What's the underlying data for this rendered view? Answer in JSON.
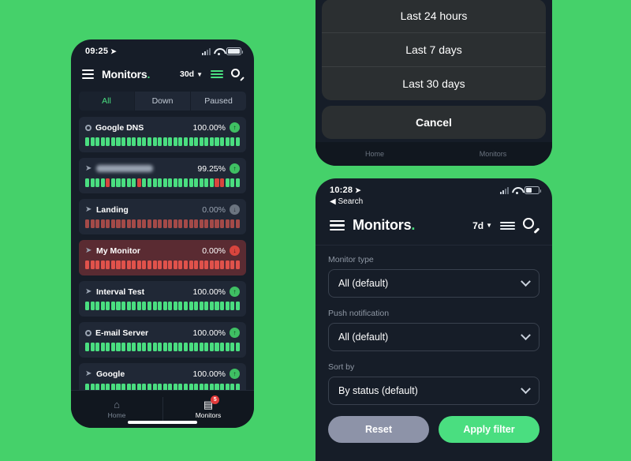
{
  "theme": {
    "background_green": "#45d16a",
    "phone_bg": "#161d28",
    "card_bg": "#202836",
    "accent_green": "#4ade80",
    "danger_red": "#d9453e",
    "down_card_bg": "#5a2b32"
  },
  "phone_left": {
    "status_bar": {
      "time": "09:25",
      "location_icon": "location-arrow-icon"
    },
    "header": {
      "menu_icon": "hamburger-menu-icon",
      "title": "Monitors",
      "title_dot": ".",
      "range_label": "30d",
      "caret_icon": "chevron-down-icon",
      "filter_icon": "filter-sliders-icon",
      "search_icon": "search-icon"
    },
    "tabs": [
      {
        "label": "All",
        "active": true
      },
      {
        "label": "Down",
        "active": false
      },
      {
        "label": "Paused",
        "active": false
      }
    ],
    "monitors": [
      {
        "name": "Google DNS",
        "uptime": "100.00%",
        "status": "up",
        "type_icon": "circle",
        "blurred": false
      },
      {
        "name": "",
        "uptime": "99.25%",
        "status": "up",
        "type_icon": "pointer",
        "blurred": true
      },
      {
        "name": "Landing",
        "uptime": "0.00%",
        "status": "paused",
        "type_icon": "pointer",
        "blurred": false
      },
      {
        "name": "My Monitor",
        "uptime": "0.00%",
        "status": "down",
        "type_icon": "pointer",
        "blurred": false
      },
      {
        "name": "Interval Test",
        "uptime": "100.00%",
        "status": "up",
        "type_icon": "pointer",
        "blurred": false
      },
      {
        "name": "E-mail Server",
        "uptime": "100.00%",
        "status": "up",
        "type_icon": "circle",
        "blurred": false
      },
      {
        "name": "Google",
        "uptime": "100.00%",
        "status": "up",
        "type_icon": "pointer",
        "blurred": false
      }
    ],
    "bottom_nav": [
      {
        "label": "Home",
        "icon": "home-icon",
        "active": false,
        "badge": ""
      },
      {
        "label": "Monitors",
        "icon": "monitors-list-icon",
        "active": true,
        "badge": "5"
      }
    ]
  },
  "phone_top_right": {
    "action_sheet": {
      "options": [
        {
          "label": "Last 24 hours"
        },
        {
          "label": "Last 7 days"
        },
        {
          "label": "Last 30 days"
        }
      ],
      "cancel_label": "Cancel"
    },
    "bottom_nav": [
      {
        "label": "Home"
      },
      {
        "label": "Monitors"
      }
    ]
  },
  "phone_bottom_right": {
    "status_bar": {
      "time": "10:28",
      "location_icon": "location-arrow-icon",
      "back_label": "Search",
      "back_icon": "back-triangle-icon"
    },
    "header": {
      "menu_icon": "hamburger-menu-icon",
      "title": "Monitors",
      "title_dot": ".",
      "range_label": "7d",
      "caret_icon": "chevron-down-icon",
      "filter_icon": "filter-sliders-icon",
      "search_icon": "search-icon"
    },
    "filter_form": {
      "fields": [
        {
          "label": "Monitor type",
          "value": "All (default)"
        },
        {
          "label": "Push notification",
          "value": "All (default)"
        },
        {
          "label": "Sort by",
          "value": "By status (default)"
        }
      ],
      "reset_label": "Reset",
      "apply_label": "Apply filter"
    }
  }
}
